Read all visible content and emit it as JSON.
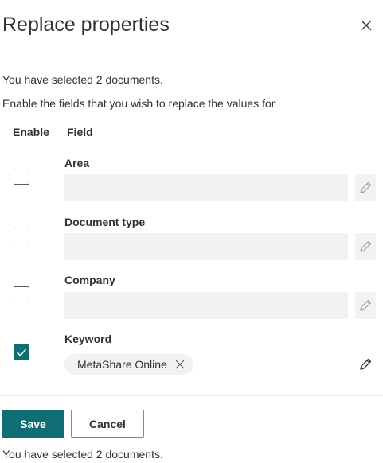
{
  "dialog": {
    "title": "Replace properties",
    "selected_text": "You have selected 2 documents.",
    "instruction": "Enable the fields that you wish to replace the values for.",
    "footer_text": "You have selected 2 documents."
  },
  "table": {
    "enable_header": "Enable",
    "field_header": "Field"
  },
  "fields": [
    {
      "label": "Area",
      "enabled": false,
      "value": ""
    },
    {
      "label": "Document type",
      "enabled": false,
      "value": ""
    },
    {
      "label": "Company",
      "enabled": false,
      "value": ""
    },
    {
      "label": "Keyword",
      "enabled": true,
      "tags": [
        "MetaShare Online"
      ]
    }
  ],
  "buttons": {
    "save": "Save",
    "cancel": "Cancel"
  },
  "icons": {
    "close": "close-icon",
    "edit": "pencil-icon",
    "check": "checkmark-icon",
    "remove_tag": "close-icon"
  },
  "colors": {
    "accent": "#0f6e73",
    "field_bg": "#f3f2f1",
    "text": "#323130"
  }
}
